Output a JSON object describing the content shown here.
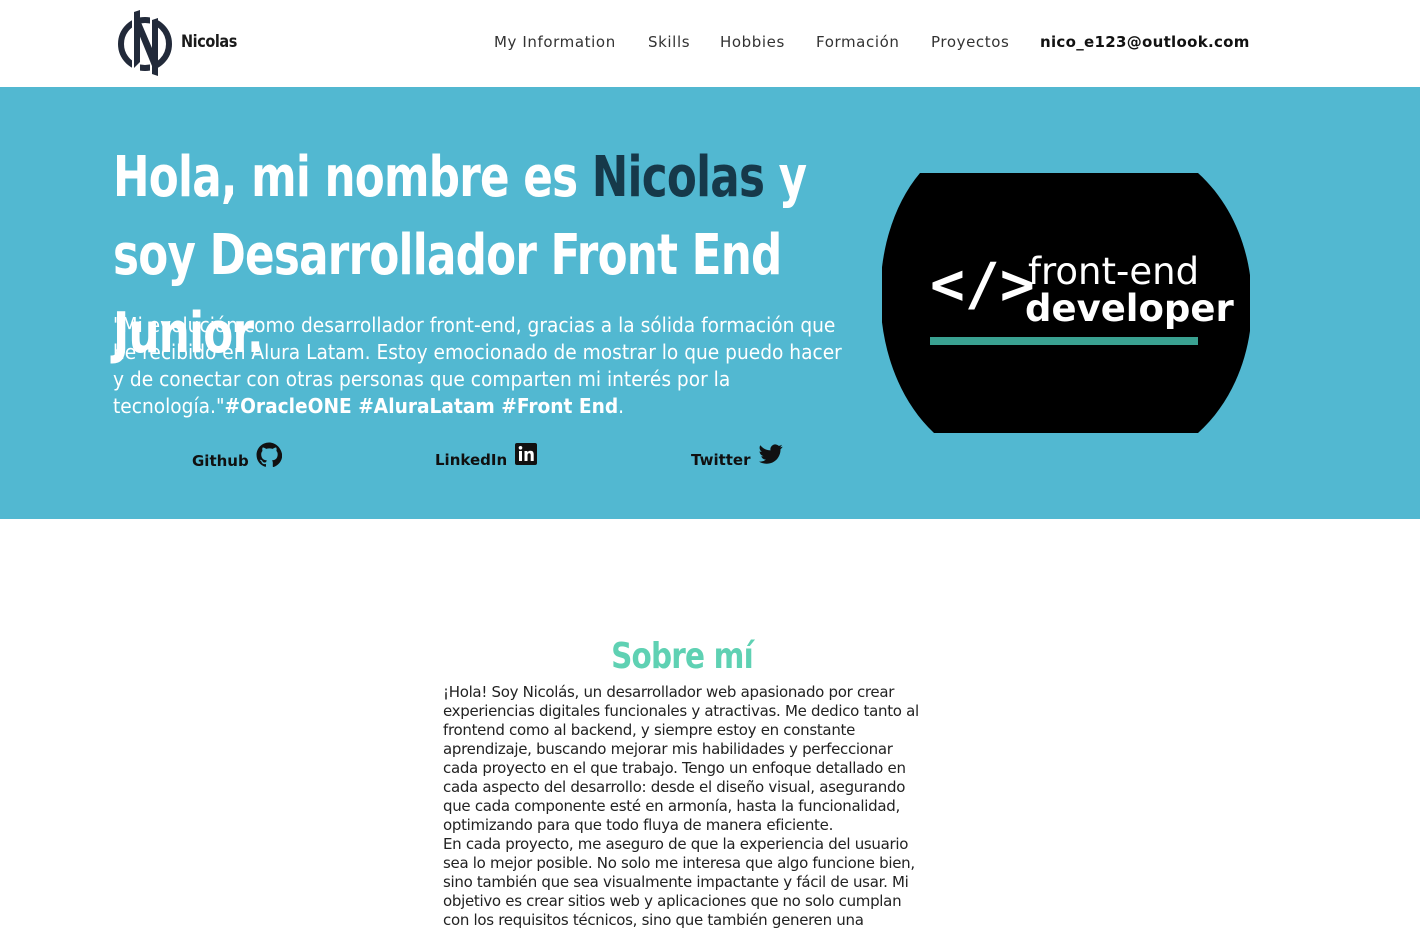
{
  "header": {
    "brand": "Nicolas",
    "nav": [
      {
        "label": "My Information"
      },
      {
        "label": "Skills"
      },
      {
        "label": "Hobbies"
      },
      {
        "label": "Formación"
      },
      {
        "label": "Proyectos"
      }
    ],
    "email": "nico_e123@outlook.com"
  },
  "hero": {
    "title_part1": "Hola, mi nombre es ",
    "title_name": "Nicolas",
    "title_part2": " y soy Desarrollador Front End Junior.",
    "quote_text": "\"Mi evolución como desarrollador front-end, gracias a la sólida formación que he recibido en Alura Latam. Estoy emocionado de mostrar lo que puedo hacer y de conectar con otras personas que comparten mi interés por la tecnología.\"",
    "quote_tags": "#OracleONE #AluraLatam #Front End",
    "quote_end": ".",
    "social": [
      {
        "label": "Github",
        "icon": "github-icon"
      },
      {
        "label": "LinkedIn",
        "icon": "linkedin-icon"
      },
      {
        "label": "Twitter",
        "icon": "twitter-icon"
      }
    ],
    "badge": {
      "code_symbol": "</>",
      "line1": "front-end",
      "line2": "developer"
    }
  },
  "about": {
    "title": "Sobre mí",
    "paragraph1": "¡Hola! Soy Nicolás, un desarrollador web apasionado por crear experiencias digitales funcionales y atractivas. Me dedico tanto al frontend como al backend, y siempre estoy en constante aprendizaje, buscando mejorar mis habilidades y perfeccionar cada proyecto en el que trabajo. Tengo un enfoque detallado en cada aspecto del desarrollo: desde el diseño visual, asegurando que cada componente esté en armonía, hasta la funcionalidad, optimizando para que todo fluya de manera eficiente.",
    "paragraph2": "En cada proyecto, me aseguro de que la experiencia del usuario sea lo mejor posible. No solo me interesa que algo funcione bien, sino también que sea visualmente impactante y fácil de usar. Mi objetivo es crear sitios web y aplicaciones que no solo cumplan con los requisitos técnicos, sino que también generen una conexión con el"
  },
  "colors": {
    "hero_bg": "#52b8d1",
    "name_highlight": "#16394a",
    "about_title": "#5fd1b3",
    "badge_accent": "#3aa191"
  }
}
